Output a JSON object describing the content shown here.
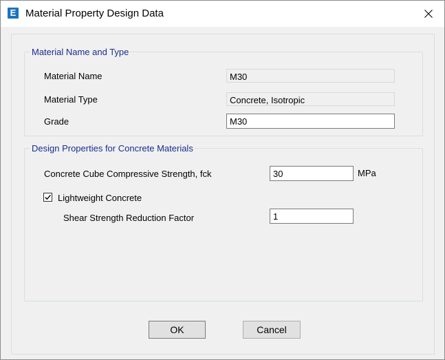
{
  "window": {
    "title": "Material Property Design Data",
    "app_icon_letter": "E"
  },
  "material_group": {
    "title": "Material Name and Type",
    "name_label": "Material Name",
    "name_value": "M30",
    "type_label": "Material Type",
    "type_value": "Concrete, Isotropic",
    "grade_label": "Grade",
    "grade_value": "M30"
  },
  "design_group": {
    "title": "Design Properties for Concrete Materials",
    "fck_label": "Concrete Cube Compressive Strength, fck",
    "fck_value": "30",
    "fck_unit": "MPa",
    "lightweight_label": "Lightweight Concrete",
    "lightweight_checked": true,
    "shear_label": "Shear Strength Reduction Factor",
    "shear_value": "1"
  },
  "buttons": {
    "ok": "OK",
    "cancel": "Cancel"
  },
  "colors": {
    "group_title": "#1a2d8f",
    "dialog_bg": "#f0f0f0",
    "app_icon": "#1e73be"
  },
  "icons": {
    "app": "etabs-app-icon",
    "close": "close-icon",
    "check": "checkmark-icon"
  }
}
